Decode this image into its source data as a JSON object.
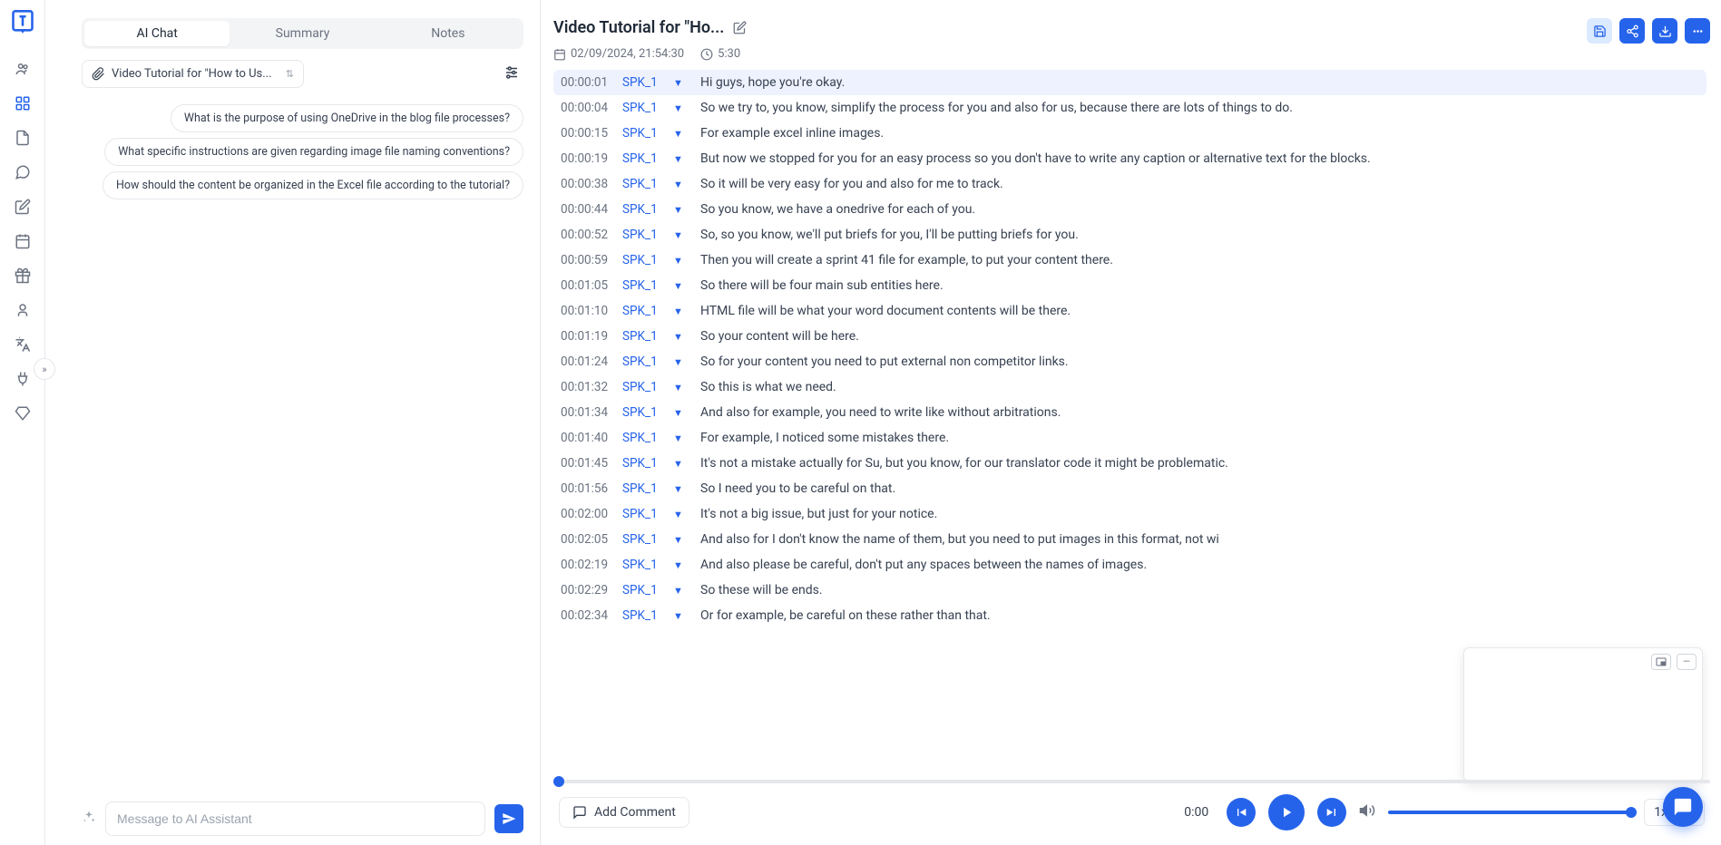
{
  "leftPanel": {
    "tabs": [
      "AI Chat",
      "Summary",
      "Notes"
    ],
    "activeTab": 0,
    "dropdownText": "Video Tutorial for \"How to Us...",
    "suggestions": [
      "What is the purpose of using OneDrive in the blog file processes?",
      "What specific instructions are given regarding image file naming conventions?",
      "How should the content be organized in the Excel file according to the tutorial?"
    ],
    "inputPlaceholder": "Message to AI Assistant"
  },
  "header": {
    "title": "Video Tutorial for \"Ho...",
    "date": "02/09/2024, 21:54:30",
    "duration": "5:30"
  },
  "transcript": [
    {
      "time": "00:00:01",
      "speaker": "SPK_1",
      "text": "Hi guys, hope you're okay.",
      "active": true
    },
    {
      "time": "00:00:04",
      "speaker": "SPK_1",
      "text": "So we try to, you know, simplify the process for you and also for us, because there are lots of things to do."
    },
    {
      "time": "00:00:15",
      "speaker": "SPK_1",
      "text": "For example excel inline images."
    },
    {
      "time": "00:00:19",
      "speaker": "SPK_1",
      "text": "But now we stopped for you for an easy process so you don't have to write any caption or alternative text for the blocks."
    },
    {
      "time": "00:00:38",
      "speaker": "SPK_1",
      "text": "So it will be very easy for you and also for me to track."
    },
    {
      "time": "00:00:44",
      "speaker": "SPK_1",
      "text": "So you know, we have a onedrive for each of you."
    },
    {
      "time": "00:00:52",
      "speaker": "SPK_1",
      "text": "So, so you know, we'll put briefs for you, I'll be putting briefs for you."
    },
    {
      "time": "00:00:59",
      "speaker": "SPK_1",
      "text": "Then you will create a sprint 41 file for example, to put your content there."
    },
    {
      "time": "00:01:05",
      "speaker": "SPK_1",
      "text": "So there will be four main sub entities here."
    },
    {
      "time": "00:01:10",
      "speaker": "SPK_1",
      "text": "HTML file will be what your word document contents will be there."
    },
    {
      "time": "00:01:19",
      "speaker": "SPK_1",
      "text": "So your content will be here."
    },
    {
      "time": "00:01:24",
      "speaker": "SPK_1",
      "text": "So for your content you need to put external non competitor links."
    },
    {
      "time": "00:01:32",
      "speaker": "SPK_1",
      "text": "So this is what we need."
    },
    {
      "time": "00:01:34",
      "speaker": "SPK_1",
      "text": "And also for example, you need to write like without arbitrations."
    },
    {
      "time": "00:01:40",
      "speaker": "SPK_1",
      "text": "For example, I noticed some mistakes there."
    },
    {
      "time": "00:01:45",
      "speaker": "SPK_1",
      "text": "It's not a mistake actually for Su, but you know, for our translator code it might be problematic."
    },
    {
      "time": "00:01:56",
      "speaker": "SPK_1",
      "text": "So I need you to be careful on that."
    },
    {
      "time": "00:02:00",
      "speaker": "SPK_1",
      "text": "It's not a big issue, but just for your notice."
    },
    {
      "time": "00:02:05",
      "speaker": "SPK_1",
      "text": "And also for I don't know the name of them, but you need to put images in this format, not wi"
    },
    {
      "time": "00:02:19",
      "speaker": "SPK_1",
      "text": "And also please be careful, don't put any spaces between the names of images."
    },
    {
      "time": "00:02:29",
      "speaker": "SPK_1",
      "text": "So these will be ends."
    },
    {
      "time": "00:02:34",
      "speaker": "SPK_1",
      "text": "Or for example, be careful on these rather than that."
    }
  ],
  "player": {
    "addComment": "Add Comment",
    "currentTime": "0:00",
    "speed": "1x"
  }
}
